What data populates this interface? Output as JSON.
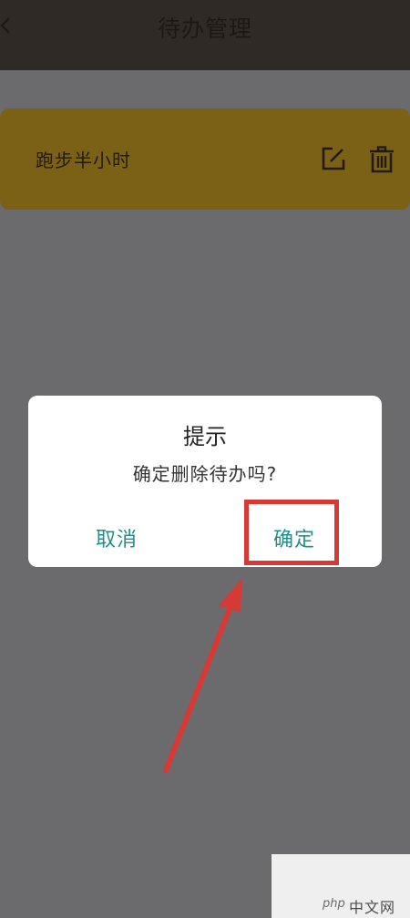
{
  "header": {
    "title": "待办管理"
  },
  "todo": {
    "text": "跑步半小时"
  },
  "dialog": {
    "title": "提示",
    "message": "确定删除待办吗?",
    "cancel_label": "取消",
    "confirm_label": "确定"
  },
  "watermark": {
    "logo": "php",
    "site": "中文网"
  },
  "colors": {
    "topbar": "#2f2a26",
    "overlay": "#6b6a6c",
    "card": "#7a6116",
    "accent": "#1f8f8d",
    "annotation": "#d63a36"
  },
  "icons": {
    "back": "chevron-left-icon",
    "edit": "edit-icon",
    "delete": "trash-icon"
  }
}
